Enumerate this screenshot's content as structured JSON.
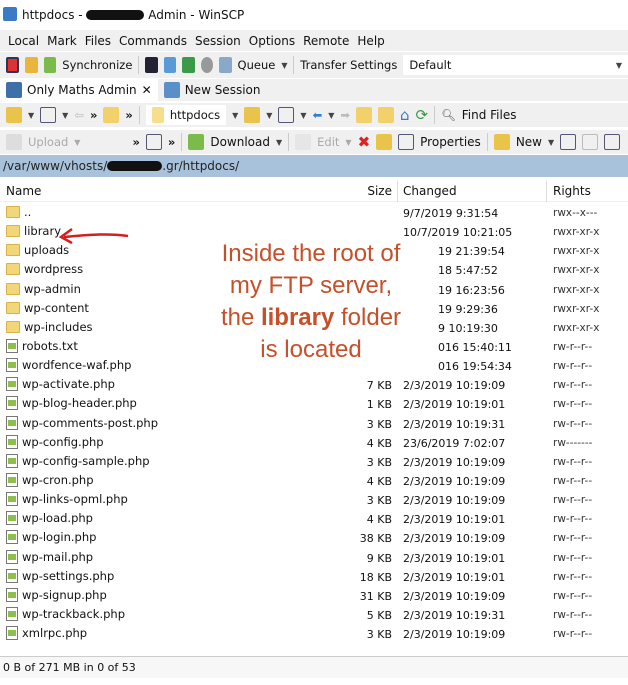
{
  "window": {
    "title_prefix": "httpdocs -",
    "title_suffix": "Admin - WinSCP"
  },
  "menu": [
    "Local",
    "Mark",
    "Files",
    "Commands",
    "Session",
    "Options",
    "Remote",
    "Help"
  ],
  "toolbar1": {
    "synchronize": "Synchronize",
    "queue": "Queue",
    "transfer_label": "Transfer Settings",
    "transfer_value": "Default"
  },
  "tabs": [
    {
      "label": "Only Maths Admin",
      "close": "✕"
    },
    {
      "label": "New Session"
    }
  ],
  "toolbar2": {
    "folder": "httpdocs",
    "find_files": "Find Files"
  },
  "toolbar3": {
    "upload": "Upload",
    "download": "Download",
    "edit": "Edit",
    "properties": "Properties",
    "new": "New"
  },
  "path": {
    "prefix": "/var/www/vhosts/",
    "suffix": ".gr/httpdocs/"
  },
  "columns": {
    "name": "Name",
    "size": "Size",
    "changed": "Changed",
    "rights": "Rights"
  },
  "files": [
    {
      "name": "..",
      "type": "up",
      "size": "",
      "changed": "9/7/2019 9:31:54",
      "rights": "rwx--x---"
    },
    {
      "name": "library",
      "type": "folder",
      "size": "",
      "changed": "10/7/2019 10:21:05",
      "rights": "rwxr-xr-x"
    },
    {
      "name": "uploads",
      "type": "folder",
      "size": "",
      "changed": "19 21:39:54",
      "rights": "rwxr-xr-x",
      "partial": true
    },
    {
      "name": "wordpress",
      "type": "folder",
      "size": "",
      "changed": "18 5:47:52",
      "rights": "rwxr-xr-x",
      "partial": true
    },
    {
      "name": "wp-admin",
      "type": "folder",
      "size": "",
      "changed": "19 16:23:56",
      "rights": "rwxr-xr-x",
      "partial": true
    },
    {
      "name": "wp-content",
      "type": "folder",
      "size": "",
      "changed": "19 9:29:36",
      "rights": "rwxr-xr-x",
      "partial": true
    },
    {
      "name": "wp-includes",
      "type": "folder",
      "size": "",
      "changed": "9 10:19:30",
      "rights": "rwxr-xr-x",
      "partial": true
    },
    {
      "name": "robots.txt",
      "type": "file",
      "size": "",
      "changed": "016 15:40:11",
      "rights": "rw-r--r--",
      "partial": true
    },
    {
      "name": "wordfence-waf.php",
      "type": "file",
      "size": "",
      "changed": "016 19:54:34",
      "rights": "rw-r--r--",
      "partial": true
    },
    {
      "name": "wp-activate.php",
      "type": "file",
      "size": "7 KB",
      "changed": "2/3/2019 10:19:09",
      "rights": "rw-r--r--"
    },
    {
      "name": "wp-blog-header.php",
      "type": "file",
      "size": "1 KB",
      "changed": "2/3/2019 10:19:01",
      "rights": "rw-r--r--"
    },
    {
      "name": "wp-comments-post.php",
      "type": "file",
      "size": "3 KB",
      "changed": "2/3/2019 10:19:31",
      "rights": "rw-r--r--"
    },
    {
      "name": "wp-config.php",
      "type": "file",
      "size": "4 KB",
      "changed": "23/6/2019 7:02:07",
      "rights": "rw-------"
    },
    {
      "name": "wp-config-sample.php",
      "type": "file",
      "size": "3 KB",
      "changed": "2/3/2019 10:19:09",
      "rights": "rw-r--r--"
    },
    {
      "name": "wp-cron.php",
      "type": "file",
      "size": "4 KB",
      "changed": "2/3/2019 10:19:09",
      "rights": "rw-r--r--"
    },
    {
      "name": "wp-links-opml.php",
      "type": "file",
      "size": "3 KB",
      "changed": "2/3/2019 10:19:09",
      "rights": "rw-r--r--"
    },
    {
      "name": "wp-load.php",
      "type": "file",
      "size": "4 KB",
      "changed": "2/3/2019 10:19:01",
      "rights": "rw-r--r--"
    },
    {
      "name": "wp-login.php",
      "type": "file",
      "size": "38 KB",
      "changed": "2/3/2019 10:19:09",
      "rights": "rw-r--r--"
    },
    {
      "name": "wp-mail.php",
      "type": "file",
      "size": "9 KB",
      "changed": "2/3/2019 10:19:01",
      "rights": "rw-r--r--"
    },
    {
      "name": "wp-settings.php",
      "type": "file",
      "size": "18 KB",
      "changed": "2/3/2019 10:19:01",
      "rights": "rw-r--r--"
    },
    {
      "name": "wp-signup.php",
      "type": "file",
      "size": "31 KB",
      "changed": "2/3/2019 10:19:09",
      "rights": "rw-r--r--"
    },
    {
      "name": "wp-trackback.php",
      "type": "file",
      "size": "5 KB",
      "changed": "2/3/2019 10:19:31",
      "rights": "rw-r--r--"
    },
    {
      "name": "xmlrpc.php",
      "type": "file",
      "size": "3 KB",
      "changed": "2/3/2019 10:19:09",
      "rights": "rw-r--r--"
    }
  ],
  "status": "0 B of 271 MB in 0 of 53",
  "annotation": {
    "line1": "Inside the root of",
    "line2": "my FTP server,",
    "line3_pre": "the ",
    "line3_bold": "library",
    "line3_post": " folder",
    "line4": "is located",
    "color": "#c5502a"
  }
}
